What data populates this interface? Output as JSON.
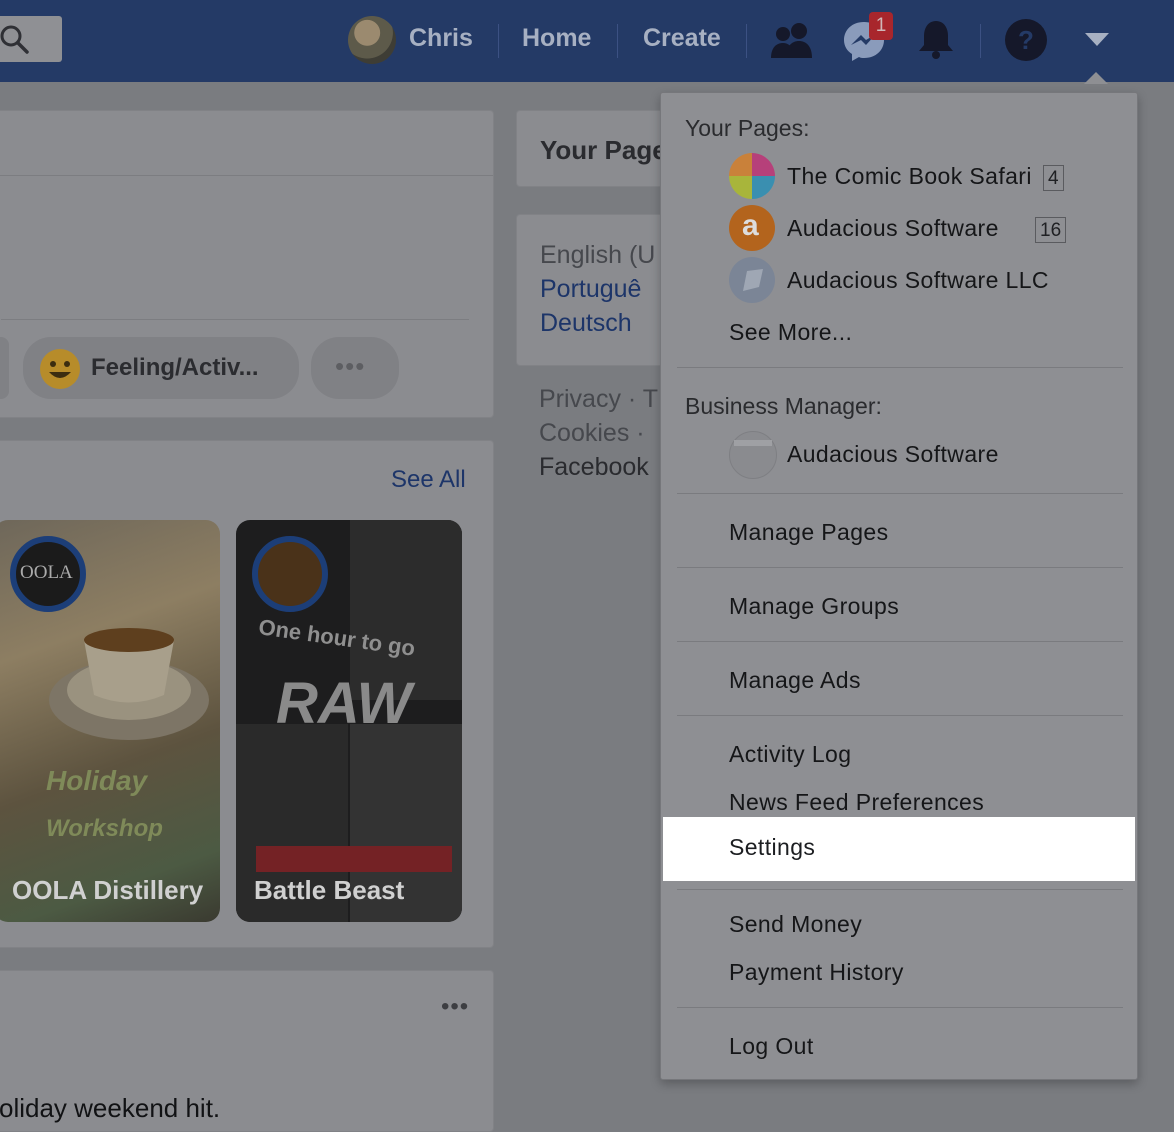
{
  "topbar": {
    "user_name": "Chris",
    "home_label": "Home",
    "create_label": "Create",
    "messages_badge": "1"
  },
  "composer": {
    "feeling_label": "Feeling/Activ..."
  },
  "stories": {
    "see_all_label": "See All",
    "items": [
      {
        "label": "OOLA Distillery"
      },
      {
        "label": "Battle Beast"
      }
    ]
  },
  "sidebar": {
    "your_pages_title": "Your Page",
    "languages": [
      "English (U",
      "Portuguê",
      "Deutsch"
    ],
    "footer_lines": [
      "Privacy · T",
      "Cookies ·",
      "Facebook"
    ]
  },
  "post": {
    "snippet": "oliday weekend hit."
  },
  "dropdown": {
    "your_pages_heading": "Your Pages:",
    "pages": [
      {
        "name": "The Comic Book Safari",
        "count": "4"
      },
      {
        "name": "Audacious Software",
        "count": "16"
      },
      {
        "name": "Audacious Software LLC",
        "count": ""
      }
    ],
    "see_more": "See More...",
    "business_heading": "Business Manager:",
    "business_item": "Audacious Software",
    "items": {
      "manage_pages": "Manage Pages",
      "manage_groups": "Manage Groups",
      "manage_ads": "Manage Ads",
      "activity_log": "Activity Log",
      "news_feed_prefs": "News Feed Preferences",
      "settings": "Settings",
      "send_money": "Send Money",
      "payment_history": "Payment History",
      "log_out": "Log Out"
    }
  },
  "colors": {
    "topbar": "#243a66",
    "overlay_bg": "#7a7c80",
    "highlight": "#ffffff",
    "badge": "#a8262c"
  }
}
